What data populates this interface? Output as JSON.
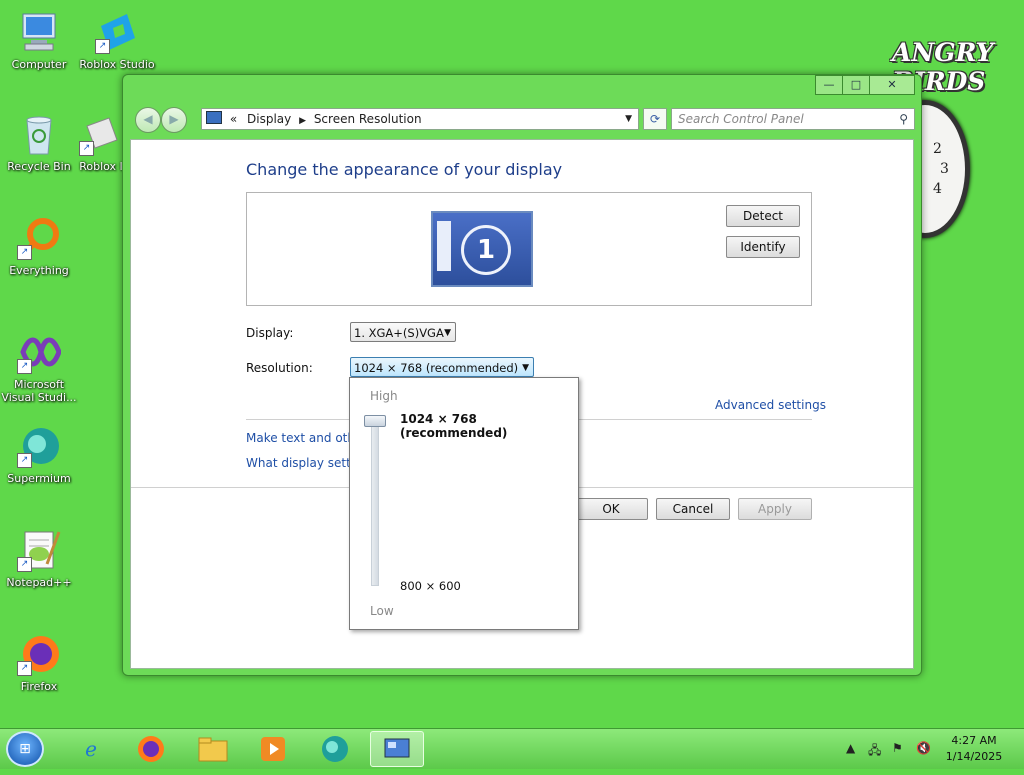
{
  "desktop": {
    "icons": [
      {
        "label": "Computer",
        "icon": "computer-icon"
      },
      {
        "label": "Roblox Studio",
        "icon": "roblox-studio-icon"
      },
      {
        "label": "Recycle Bin",
        "icon": "recycle-bin-icon"
      },
      {
        "label": "Roblox I",
        "icon": "roblox-icon"
      },
      {
        "label": "Everything",
        "icon": "everything-icon"
      },
      {
        "label": "Microsoft Visual Studi...",
        "icon": "visual-studio-icon"
      },
      {
        "label": "Supermium",
        "icon": "supermium-icon"
      },
      {
        "label": "Notepad++",
        "icon": "notepad-plus-plus-icon"
      },
      {
        "label": "Firefox",
        "icon": "firefox-icon"
      }
    ],
    "angry_birds": "ANGRY BIRDS",
    "clock_numbers": [
      "2",
      "3",
      "4"
    ]
  },
  "window": {
    "breadcrumb": {
      "chevron": "«",
      "item1": "Display",
      "item2": "Screen Resolution"
    },
    "search_placeholder": "Search Control Panel",
    "caption": {
      "minimize": "—",
      "maximize": "□",
      "close": "✕"
    },
    "title": "Change the appearance of your display",
    "monitor_number": "1",
    "detect_label": "Detect",
    "identify_label": "Identify",
    "display_label": "Display:",
    "display_value": "1. XGA+(S)VGA",
    "resolution_label": "Resolution:",
    "resolution_value": "1024 × 768 (recommended)",
    "advanced_settings": "Advanced settings",
    "link1": "Make text and other",
    "link2": "What display setting",
    "ok_label": "OK",
    "cancel_label": "Cancel",
    "apply_label": "Apply"
  },
  "resolution_popup": {
    "high_label": "High",
    "low_label": "Low",
    "current": "1024 × 768 (recommended)",
    "min": "800 × 600",
    "slider_level": 1.0
  },
  "taskbar": {
    "time": "4:27 AM",
    "date": "1/14/2025",
    "apps": [
      "internet-explorer-icon",
      "firefox-icon",
      "file-explorer-icon",
      "media-player-icon",
      "supermium-icon",
      "control-panel-icon"
    ]
  }
}
